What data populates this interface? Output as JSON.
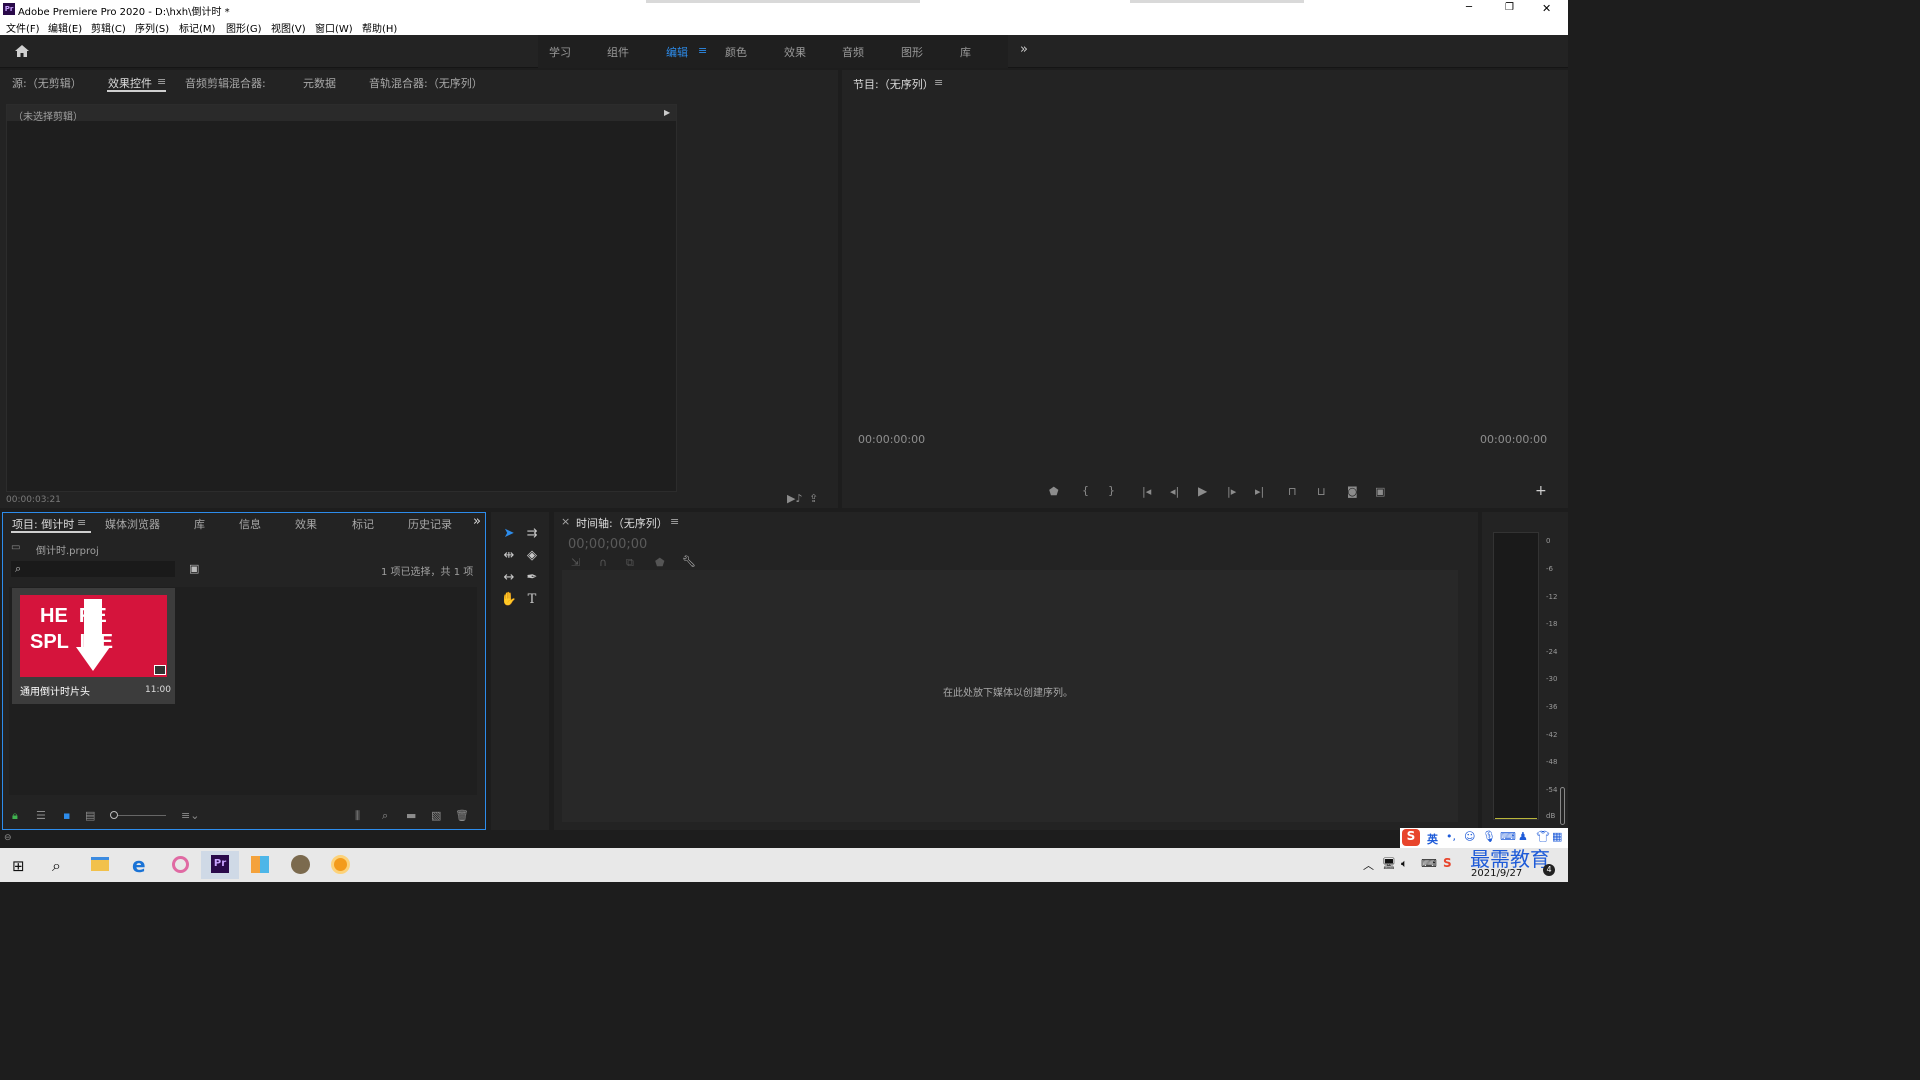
{
  "window": {
    "app_icon": "Pr",
    "title": "Adobe Premiere Pro 2020 - D:\\hxh\\倒计时 *",
    "minimize": "─",
    "restore": "❐",
    "close": "✕"
  },
  "menu": [
    "文件(F)",
    "编辑(E)",
    "剪辑(C)",
    "序列(S)",
    "标记(M)",
    "图形(G)",
    "视图(V)",
    "窗口(W)",
    "帮助(H)"
  ],
  "workspace": {
    "tabs": [
      "学习",
      "组件",
      "编辑",
      "颜色",
      "效果",
      "音频",
      "图形",
      "库"
    ],
    "active": "编辑",
    "more": "»"
  },
  "source_panel": {
    "tabs": [
      "源:（无剪辑）",
      "效果控件",
      "音频剪辑混合器:",
      "元数据",
      "音轨混合器:（无序列）"
    ],
    "active_tab": "效果控件",
    "no_clip": "（未选择剪辑）",
    "timecode": "00:00:03:21"
  },
  "program_panel": {
    "tab": "节目:（无序列）",
    "timecode_left": "00:00:00:00",
    "timecode_right": "00:00:00:00",
    "add": "+"
  },
  "project_panel": {
    "tabs": [
      "项目: 倒计时",
      "媒体浏览器",
      "库",
      "信息",
      "效果",
      "标记",
      "历史记录"
    ],
    "active_tab": "项目: 倒计时",
    "more": "»",
    "file": "倒计时.prproj",
    "search_placeholder": "",
    "selection_info": "1 项已选择，共 1 项",
    "item": {
      "name": "通用倒计时片头",
      "duration": "11:00",
      "thumb_line1": "HE  RE",
      "thumb_line2": "SPL  ICE",
      "thumb_color": "#d5143c"
    }
  },
  "timeline_panel": {
    "close": "×",
    "tab": "时间轴:（无序列）",
    "timecode": "00;00;00;00",
    "drop_hint": "在此处放下媒体以创建序列。"
  },
  "audio_meter": {
    "ticks": [
      "0",
      "-6",
      "-12",
      "-18",
      "-24",
      "-30",
      "-36",
      "-42",
      "-48",
      "-54",
      "dB"
    ]
  },
  "tray": {
    "ime": "英",
    "time": "",
    "date": "2021/9/27",
    "watermark": "最需教育",
    "badge": "4"
  },
  "colors": {
    "accent": "#2d8ceb",
    "panel": "#232323",
    "bg": "#1d1d1d"
  }
}
